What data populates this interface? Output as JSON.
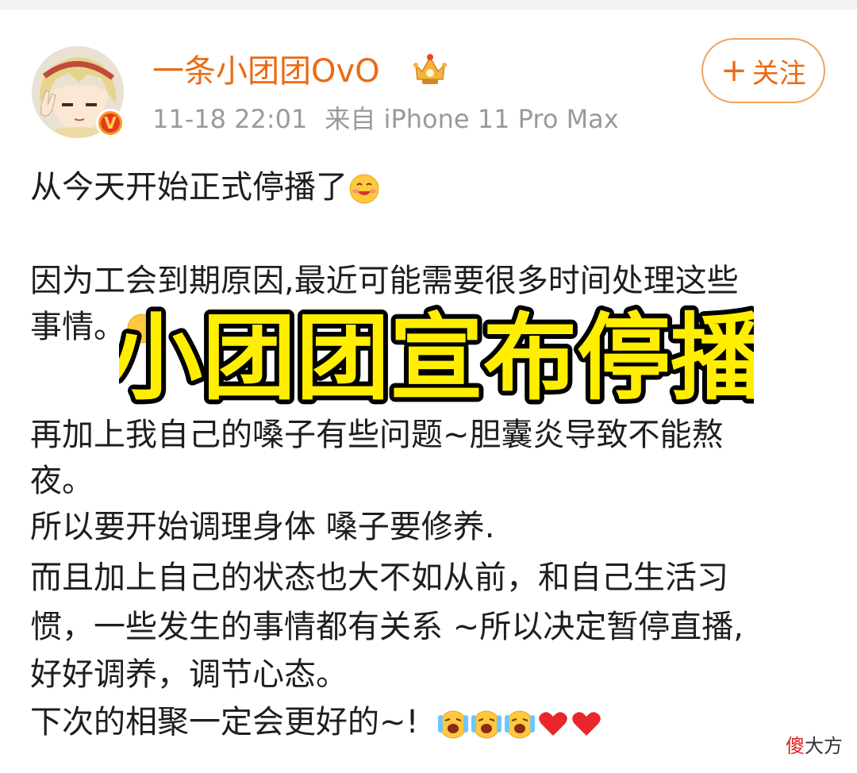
{
  "header": {
    "username": "一条小团团OvO",
    "timestamp": "11-18 22:01",
    "source": "来自 iPhone 11 Pro Max",
    "follow_label": "关注",
    "follow_plus": "+",
    "verified_badge": "V",
    "icons": {
      "avatar": "anime-avatar",
      "verified": "verified-badge-icon",
      "vip": "crown-icon"
    }
  },
  "post": {
    "lines": [
      "从今天开始正式停播了",
      "因为工会到期原因,最近可能需要很多时间处理这些",
      "事情。",
      "再加上我自己的嗓子有些问题~胆囊炎导致不能熬",
      "夜。",
      "所以要开始调理身体 嗓子要修养.",
      "而且加上自己的状态也大不如从前，和自己生活习",
      "惯，一些发生的事情都有关系 ~所以决定暂停直播,",
      "好好调养，调节心态。",
      "下次的相聚一定会更好的~!"
    ]
  },
  "overlay": {
    "caption": "小团团宣布停播"
  },
  "watermark": {
    "first": "傻",
    "rest": "大方"
  },
  "colors": {
    "accent": "#ec6a13",
    "meta": "#9a9a9a",
    "caption_fill": "#ffee00",
    "caption_stroke": "#000000",
    "heart": "#e8262b"
  }
}
